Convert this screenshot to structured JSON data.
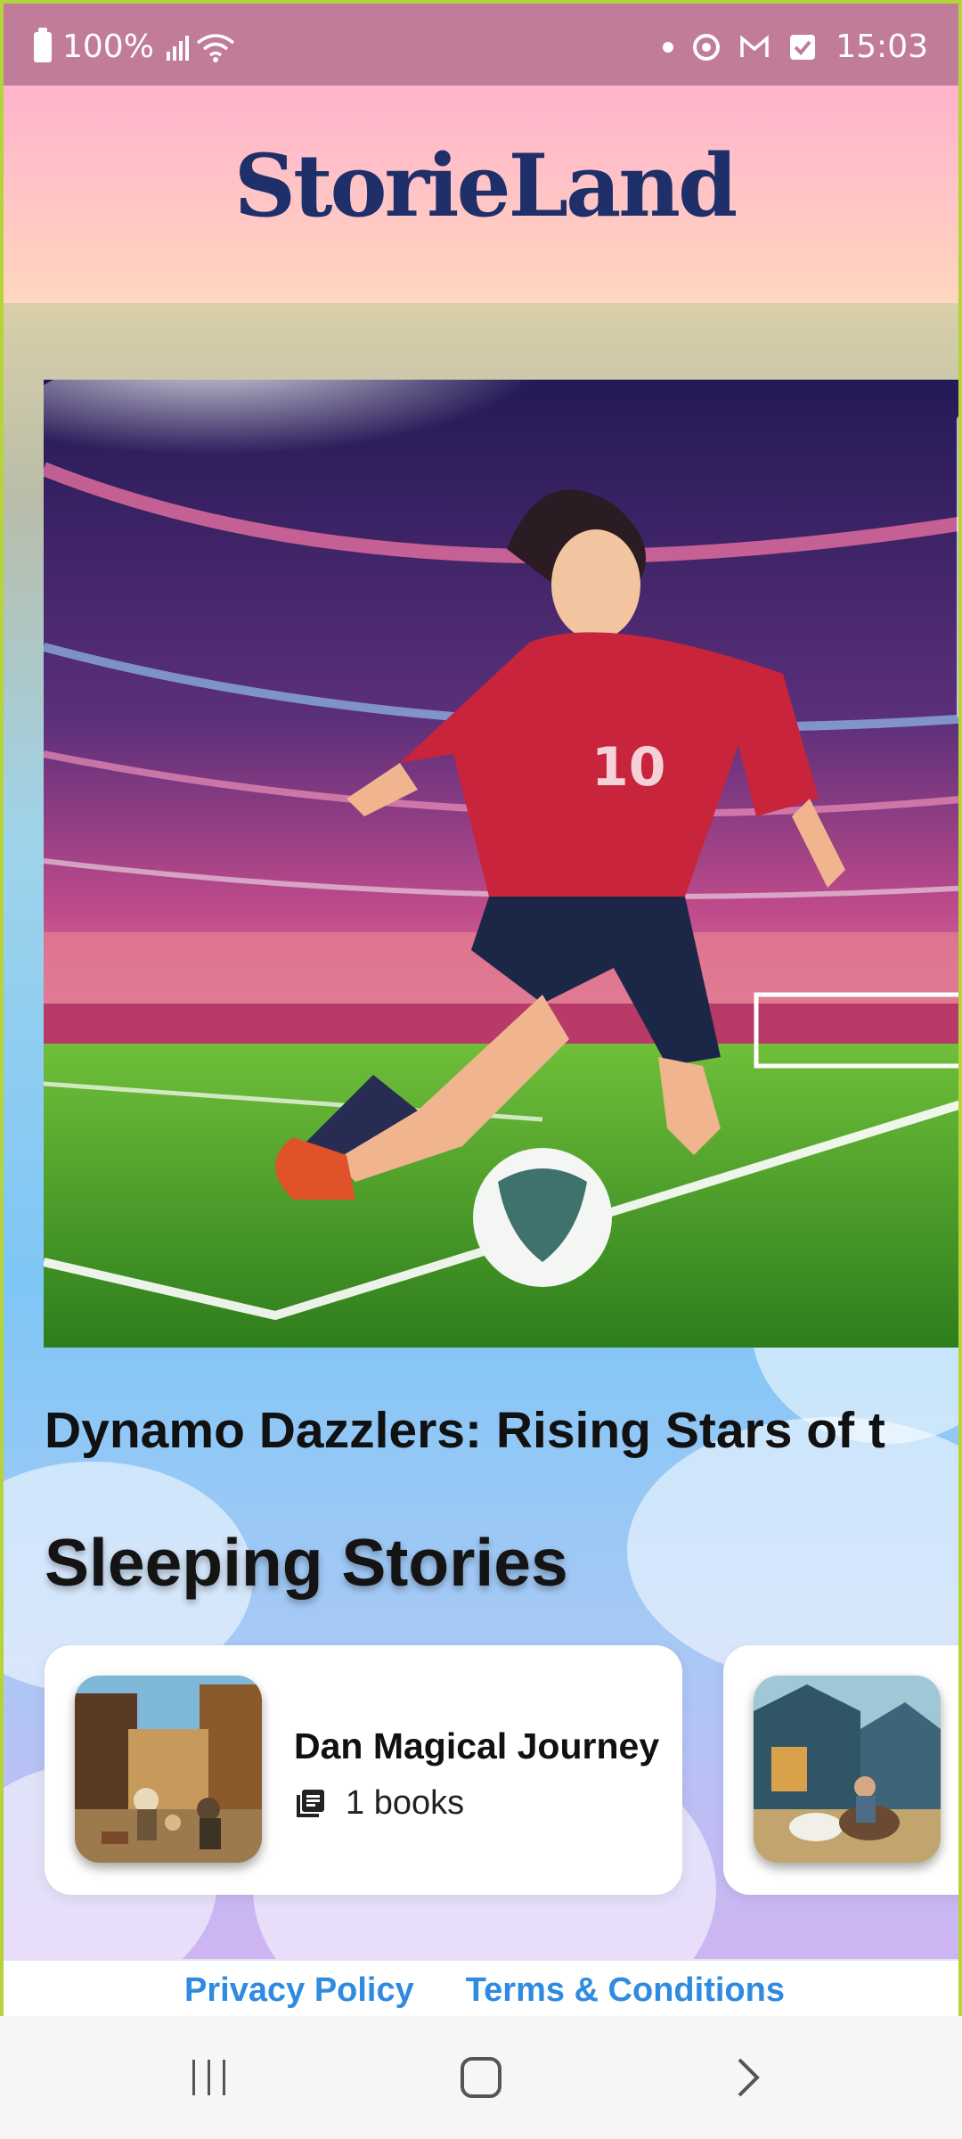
{
  "status_bar": {
    "battery": "100%",
    "time": "15:03"
  },
  "header": {
    "logo": "StorieLand"
  },
  "hero": {
    "image_alt": "Anime soccer player in red jersey number 10 kicking ball in stadium",
    "jersey_number": "10",
    "title": "Dynamo Dazzlers: Rising Stars of t"
  },
  "section": {
    "title": "Sleeping Stories"
  },
  "stories": [
    {
      "title": "Dan Magical Journey",
      "count": "1 books"
    },
    {
      "title": "",
      "count": ""
    }
  ],
  "footer": {
    "privacy": "Privacy Policy",
    "terms": "Terms & Conditions"
  },
  "colors": {
    "status_bar": "#c07c99",
    "logo": "#1f2f6a",
    "link": "#2f8be0",
    "frame": "#b5d33a"
  }
}
